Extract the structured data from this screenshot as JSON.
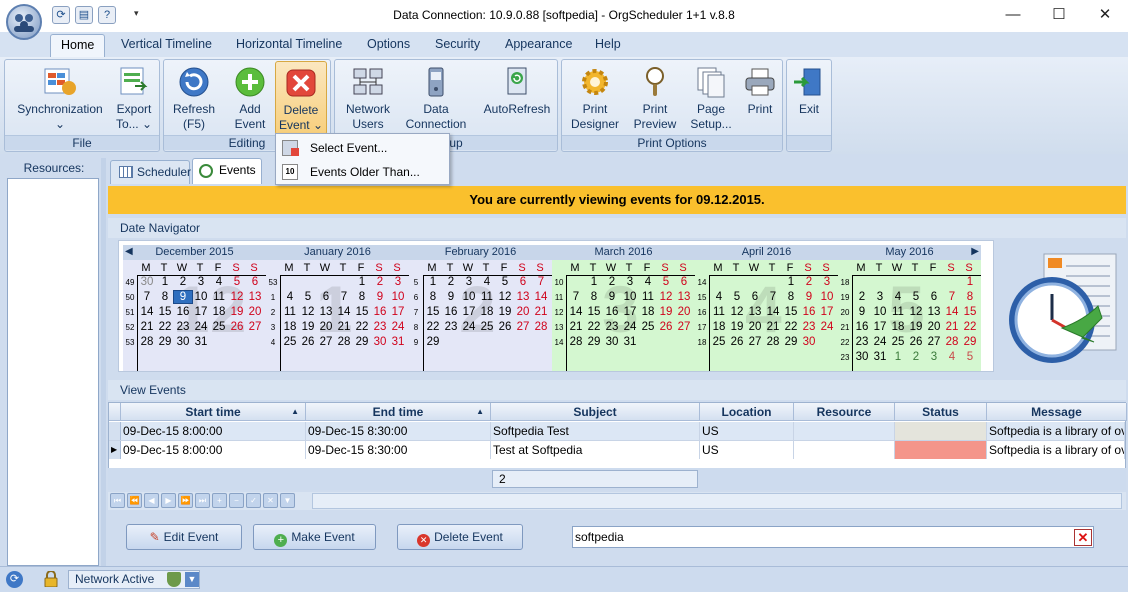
{
  "window": {
    "title": "Data Connection: 10.9.0.88 [softpedia] - OrgScheduler 1+1 v.8.8",
    "minimize": "—",
    "maximize": "☐",
    "close": "✕"
  },
  "menu_tabs": [
    "Home",
    "Vertical Timeline",
    "Horizontal Timeline",
    "Options",
    "Security",
    "Appearance",
    "Help"
  ],
  "ribbon": {
    "groups": {
      "file": "File",
      "editing": "Editing",
      "group": "Group",
      "print_options": "Print Options"
    },
    "buttons": {
      "sync": [
        "Synchronization",
        "⌄"
      ],
      "export": [
        "Export",
        "To... ⌄"
      ],
      "refresh": [
        "Refresh",
        "(F5)"
      ],
      "add": [
        "Add",
        "Event"
      ],
      "delete": [
        "Delete",
        "Event ⌄"
      ],
      "network": [
        "Network",
        "Users"
      ],
      "dataconn": [
        "Data",
        "Connection"
      ],
      "autorefresh": "AutoRefresh",
      "printdesigner": [
        "Print",
        "Designer"
      ],
      "printpreview": [
        "Print",
        "Preview"
      ],
      "pagesetup": [
        "Page",
        "Setup..."
      ],
      "print": "Print",
      "exit": "Exit"
    }
  },
  "dropdown": {
    "items": [
      "Select Event...",
      "Events Older Than..."
    ]
  },
  "left_pane": {
    "header": "Resources:"
  },
  "view_tabs": [
    "Scheduler",
    "Events"
  ],
  "banner": "You are currently viewing events for 09.12.2015.",
  "date_navigator": {
    "header": "Date Navigator",
    "dow": [
      "M",
      "T",
      "W",
      "T",
      "F",
      "S",
      "S"
    ],
    "months": [
      {
        "name": "December 2015",
        "big": "12",
        "weeks": [
          "49",
          "50",
          "51",
          "52",
          "53"
        ],
        "lead": 0,
        "days": [
          30,
          1,
          2,
          3,
          4,
          5,
          6,
          7,
          8,
          9,
          10,
          11,
          12,
          13,
          14,
          15,
          16,
          17,
          18,
          19,
          20,
          21,
          22,
          23,
          24,
          25,
          26,
          27,
          28,
          29,
          30,
          31
        ],
        "selected": 9,
        "grayLeading": 1
      },
      {
        "name": "January 2016",
        "big": "1",
        "weeks": [
          "53",
          "1",
          "2",
          "3",
          "4"
        ],
        "lead": 4,
        "days": [
          1,
          2,
          3,
          4,
          5,
          6,
          7,
          8,
          9,
          10,
          11,
          12,
          13,
          14,
          15,
          16,
          17,
          18,
          19,
          20,
          21,
          22,
          23,
          24,
          25,
          26,
          27,
          28,
          29,
          30,
          31
        ]
      },
      {
        "name": "February 2016",
        "big": "2",
        "weeks": [
          "5",
          "6",
          "7",
          "8",
          "9"
        ],
        "lead": 0,
        "days": [
          1,
          2,
          3,
          4,
          5,
          6,
          7,
          8,
          9,
          10,
          11,
          12,
          13,
          14,
          15,
          16,
          17,
          18,
          19,
          20,
          21,
          22,
          23,
          24,
          25,
          26,
          27,
          28,
          29
        ]
      },
      {
        "name": "March 2016",
        "big": "3",
        "weeks": [
          "10",
          "11",
          "12",
          "13",
          "14"
        ],
        "lead": 1,
        "days": [
          1,
          2,
          3,
          4,
          5,
          6,
          7,
          8,
          9,
          10,
          11,
          12,
          13,
          14,
          15,
          16,
          17,
          18,
          19,
          20,
          21,
          22,
          23,
          24,
          25,
          26,
          27,
          28,
          29,
          30,
          31
        ]
      },
      {
        "name": "April 2016",
        "big": "4",
        "weeks": [
          "14",
          "15",
          "16",
          "17",
          "18"
        ],
        "lead": 4,
        "days": [
          1,
          2,
          3,
          4,
          5,
          6,
          7,
          8,
          9,
          10,
          11,
          12,
          13,
          14,
          15,
          16,
          17,
          18,
          19,
          20,
          21,
          22,
          23,
          24,
          25,
          26,
          27,
          28,
          29,
          30
        ]
      },
      {
        "name": "May 2016",
        "big": "5",
        "weeks": [
          "18",
          "19",
          "20",
          "21",
          "22",
          "23"
        ],
        "lead": 6,
        "days": [
          1,
          2,
          3,
          4,
          5,
          6,
          7,
          8,
          9,
          10,
          11,
          12,
          13,
          14,
          15,
          16,
          17,
          18,
          19,
          20,
          21,
          22,
          23,
          24,
          25,
          26,
          27,
          28,
          29,
          30,
          31
        ],
        "trail": [
          1,
          2,
          3,
          4,
          5
        ]
      }
    ]
  },
  "view_events": {
    "header": "View Events",
    "columns": [
      "Start time",
      "End time",
      "Subject",
      "Location",
      "Resource",
      "Status",
      "Message"
    ],
    "rows": [
      {
        "start": "09-Dec-15 8:00:00",
        "end": "09-Dec-15 8:30:00",
        "subject": "Softpedia Test",
        "location": "US",
        "resource": "",
        "status_color": "#e4e4dc",
        "message": "Softpedia is a library of ove"
      },
      {
        "start": "09-Dec-15 8:00:00",
        "end": "09-Dec-15 8:30:00",
        "subject": "Test at Softpedia",
        "location": "US",
        "resource": "",
        "status_color": "#f4958a",
        "message": "Softpedia is a library of ove"
      }
    ],
    "count": "2",
    "nav_buttons": [
      "⏮",
      "⏪",
      "◀",
      "▶",
      "⏩",
      "⏭",
      "+",
      "−",
      "✓",
      "✕",
      "▼"
    ]
  },
  "actions": {
    "edit": "Edit Event",
    "make": "Make Event",
    "delete": "Delete Event"
  },
  "search": {
    "value": "softpedia"
  },
  "status": {
    "network": "Network Active"
  },
  "colors": {
    "banner": "#fac02d",
    "accent": "#15355e",
    "selected": "#2f6fbf",
    "weekend": "#d0021b"
  }
}
